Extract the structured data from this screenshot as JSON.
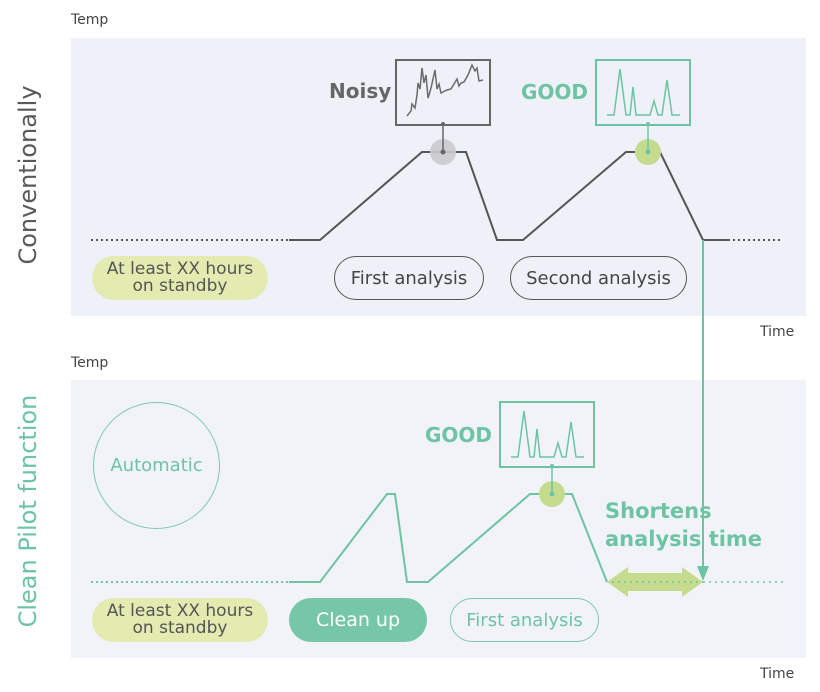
{
  "top": {
    "side_title": "Conventionally",
    "y_axis_label": "Temp",
    "x_axis_label": "Time",
    "noisy_label": "Noisy",
    "good_label": "GOOD",
    "standby_pill": "At least XX hours on standby",
    "standby_line1": "At least XX hours",
    "standby_line2": "on standby",
    "first_analysis": "First analysis",
    "second_analysis": "Second analysis"
  },
  "bottom": {
    "side_title": "Clean Pilot function",
    "y_axis_label": "Temp",
    "x_axis_label": "Time",
    "automatic": "Automatic",
    "good_label": "GOOD",
    "shortens_line1": "Shortens",
    "shortens_line2": "analysis time",
    "standby_line1": "At least XX hours",
    "standby_line2": "on standby",
    "clean_up": "Clean up",
    "first_analysis": "First analysis"
  },
  "colors": {
    "gray_line": "#555555",
    "green": "#6cc4a2",
    "lime_highlight": "#c5dc8e",
    "standby_fill": "#e3ebb0"
  }
}
